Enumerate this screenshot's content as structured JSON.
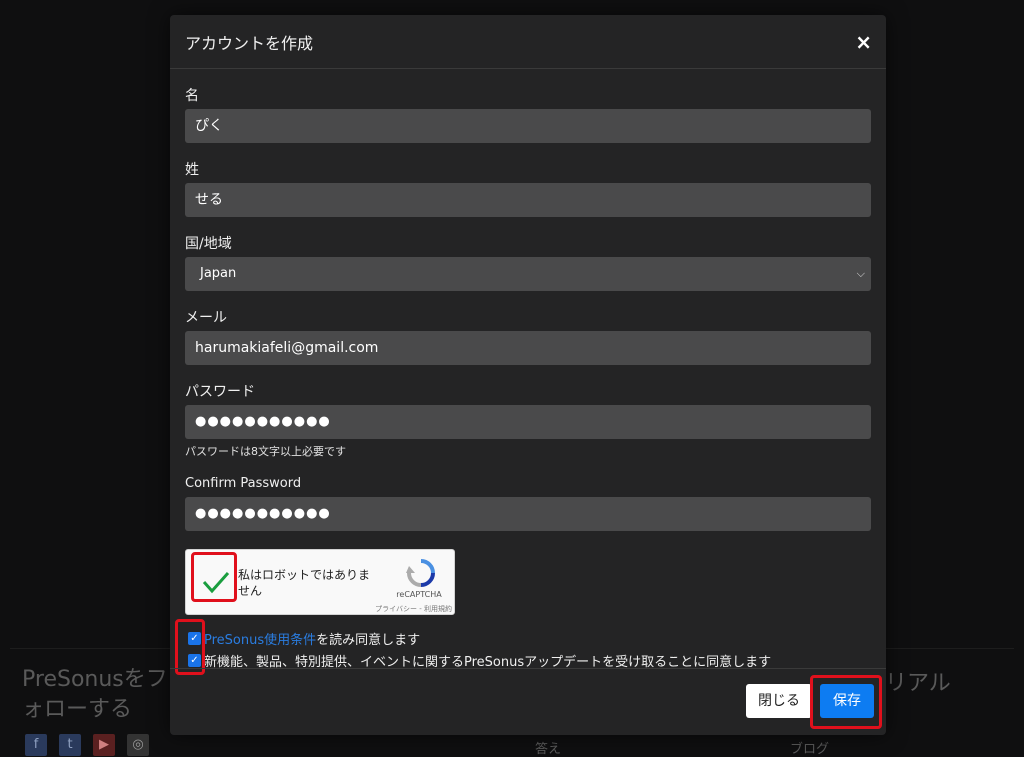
{
  "background": {
    "follow_text": "PreSonusをフォローする",
    "right_text": "リアル",
    "link_answers": "答え",
    "link_blog": "ブログ",
    "social_icons": [
      "facebook-icon",
      "twitter-icon",
      "youtube-icon",
      "instagram-icon"
    ]
  },
  "modal": {
    "title": "アカウントを作成",
    "close_glyph": "×",
    "fields": {
      "first_name": {
        "label": "名",
        "value": "ぴく"
      },
      "last_name": {
        "label": "姓",
        "value": "せる"
      },
      "country": {
        "label": "国/地域",
        "value": "Japan"
      },
      "email": {
        "label": "メール",
        "value": "harumakiafeli@gmail.com"
      },
      "password": {
        "label": "パスワード",
        "value": "●●●●●●●●●●●",
        "help": "パスワードは8文字以上必要です"
      },
      "confirm_password": {
        "label": "Confirm Password",
        "value": "●●●●●●●●●●●"
      }
    },
    "recaptcha": {
      "text": "私はロボットではありません",
      "brand": "reCAPTCHA",
      "links": "プライバシー - 利用規約",
      "checked": true
    },
    "agreements": {
      "terms_link": "PreSonus使用条件",
      "terms_rest": "を読み同意します",
      "updates": "新機能、製品、特別提供、イベントに関するPreSonusアップデートを受け取ることに同意します"
    },
    "buttons": {
      "close": "閉じる",
      "save": "保存"
    },
    "colors": {
      "highlight": "#e0101c",
      "save_button": "#0d7cf2",
      "checkmark": "#1a9e3f"
    }
  }
}
